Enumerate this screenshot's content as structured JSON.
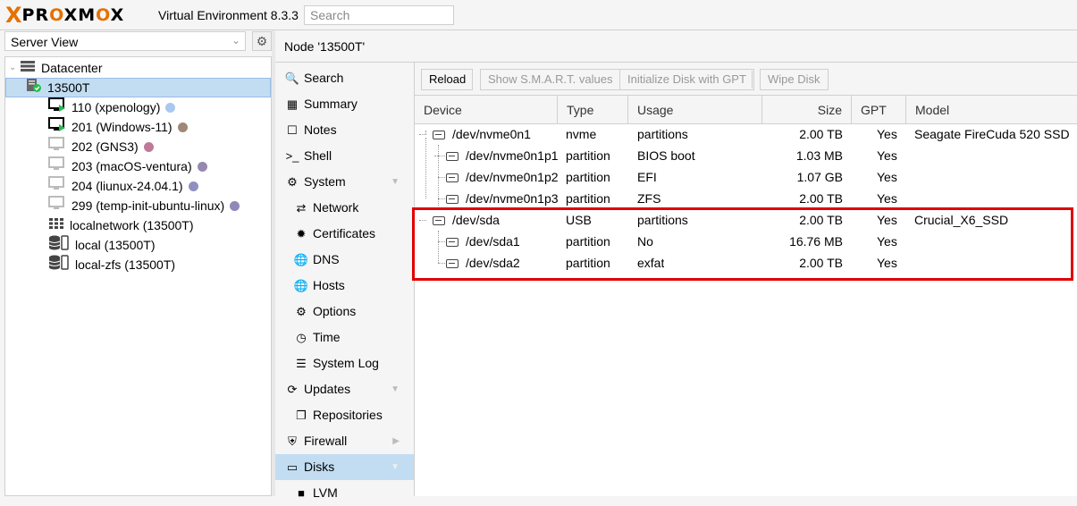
{
  "header": {
    "logo_x": "X",
    "logo_text_1": "PR",
    "logo_text_o1": "O",
    "logo_text_2": "XM",
    "logo_text_o2": "O",
    "logo_text_3": "X",
    "version": "Virtual Environment 8.3.3",
    "search_placeholder": "Search"
  },
  "left": {
    "view_label": "Server View",
    "tree": [
      {
        "label": "Datacenter",
        "icon": "datacenter-icon"
      },
      {
        "label": "13500T",
        "icon": "node-icon"
      },
      {
        "label": "110 (xpenology)",
        "icon": "vm-running-icon",
        "dot": "#a8c8f0"
      },
      {
        "label": "201 (Windows-11)",
        "icon": "vm-running-icon",
        "dot": "#a08878"
      },
      {
        "label": "202 (GNS3)",
        "icon": "vm-icon",
        "dot": "#c07898"
      },
      {
        "label": "203 (macOS-ventura)",
        "icon": "vm-icon",
        "dot": "#9888b0"
      },
      {
        "label": "204 (liunux-24.04.1)",
        "icon": "vm-icon",
        "dot": "#9090c0"
      },
      {
        "label": "299 (temp-init-ubuntu-linux)",
        "icon": "vm-icon",
        "dot": "#9088b8"
      },
      {
        "label": "localnetwork (13500T)",
        "icon": "network-grid-icon"
      },
      {
        "label": "local (13500T)",
        "icon": "storage-icon"
      },
      {
        "label": "local-zfs (13500T)",
        "icon": "storage-icon"
      }
    ]
  },
  "content": {
    "title": "Node '13500T'",
    "nav": [
      {
        "label": "Search",
        "icon": "search-icon"
      },
      {
        "label": "Summary",
        "icon": "book-icon"
      },
      {
        "label": "Notes",
        "icon": "notes-icon"
      },
      {
        "label": "Shell",
        "icon": "terminal-icon"
      },
      {
        "label": "System",
        "icon": "gears-icon"
      },
      {
        "label": "Network",
        "icon": "network-icon"
      },
      {
        "label": "Certificates",
        "icon": "certificate-icon"
      },
      {
        "label": "DNS",
        "icon": "globe-icon"
      },
      {
        "label": "Hosts",
        "icon": "globe-icon"
      },
      {
        "label": "Options",
        "icon": "gear-icon"
      },
      {
        "label": "Time",
        "icon": "clock-icon"
      },
      {
        "label": "System Log",
        "icon": "list-icon"
      },
      {
        "label": "Updates",
        "icon": "refresh-icon"
      },
      {
        "label": "Repositories",
        "icon": "files-icon"
      },
      {
        "label": "Firewall",
        "icon": "shield-icon"
      },
      {
        "label": "Disks",
        "icon": "disk-icon"
      },
      {
        "label": "LVM",
        "icon": "square-icon"
      }
    ],
    "toolbar": {
      "reload": "Reload",
      "smart": "Show S.M.A.R.T. values",
      "init_gpt": "Initialize Disk with GPT",
      "wipe": "Wipe Disk"
    },
    "columns": [
      "Device",
      "Type",
      "Usage",
      "Size",
      "GPT",
      "Model"
    ],
    "disks": [
      {
        "device": "/dev/nvme0n1",
        "type": "nvme",
        "usage": "partitions",
        "size": "2.00 TB",
        "gpt": "Yes",
        "model": "Seagate FireCuda 520 SSD ..."
      },
      {
        "device": "/dev/nvme0n1p1",
        "type": "partition",
        "usage": "BIOS boot",
        "size": "1.03 MB",
        "gpt": "Yes",
        "model": ""
      },
      {
        "device": "/dev/nvme0n1p2",
        "type": "partition",
        "usage": "EFI",
        "size": "1.07 GB",
        "gpt": "Yes",
        "model": ""
      },
      {
        "device": "/dev/nvme0n1p3",
        "type": "partition",
        "usage": "ZFS",
        "size": "2.00 TB",
        "gpt": "Yes",
        "model": ""
      },
      {
        "device": "/dev/sda",
        "type": "USB",
        "usage": "partitions",
        "size": "2.00 TB",
        "gpt": "Yes",
        "model": "Crucial_X6_SSD"
      },
      {
        "device": "/dev/sda1",
        "type": "partition",
        "usage": "No",
        "size": "16.76 MB",
        "gpt": "Yes",
        "model": ""
      },
      {
        "device": "/dev/sda2",
        "type": "partition",
        "usage": "exfat",
        "size": "2.00 TB",
        "gpt": "Yes",
        "model": ""
      }
    ]
  },
  "colors": {
    "brand_orange": "#e57000",
    "selection": "#c2ddf2",
    "highlight_red": "#e00000"
  }
}
